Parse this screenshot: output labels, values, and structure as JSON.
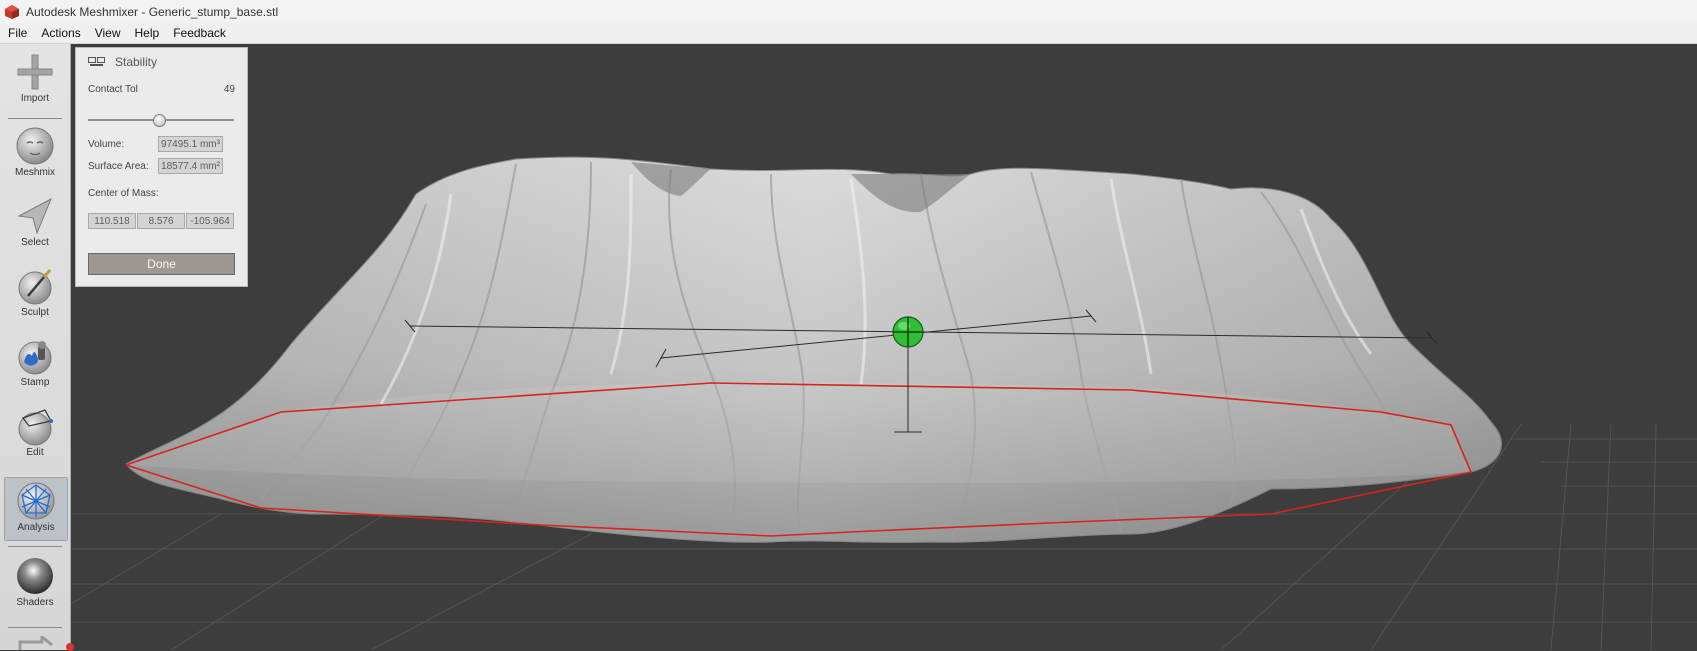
{
  "window": {
    "title": "Autodesk Meshmixer - Generic_stump_base.stl"
  },
  "menu": {
    "items": [
      "File",
      "Actions",
      "View",
      "Help",
      "Feedback"
    ]
  },
  "toolbar": {
    "tools": [
      {
        "label": "Import",
        "icon": "plus-icon"
      },
      {
        "label": "Meshmix",
        "icon": "meshmix-face-icon"
      },
      {
        "label": "Select",
        "icon": "select-arrow-icon"
      },
      {
        "label": "Sculpt",
        "icon": "sculpt-brush-icon"
      },
      {
        "label": "Stamp",
        "icon": "stamp-icon"
      },
      {
        "label": "Edit",
        "icon": "edit-sphere-icon"
      },
      {
        "label": "Analysis",
        "icon": "analysis-globe-icon",
        "active": true
      },
      {
        "label": "Shaders",
        "icon": "shader-ball-icon"
      }
    ]
  },
  "panel": {
    "title": "Stability",
    "contact_tol": {
      "label": "Contact Tol",
      "value": "49",
      "fraction": 0.49
    },
    "volume": {
      "label": "Volume:",
      "value": "97495.1 mm³"
    },
    "surface_area": {
      "label": "Surface Area:",
      "value": "18577.4 mm²"
    },
    "center_of_mass": {
      "label": "Center of Mass:",
      "x": "110.518",
      "y": "8.576",
      "z": "-105.964"
    },
    "done_label": "Done"
  },
  "colors": {
    "viewport_bg": "#3d3d3d",
    "base_outline": "#d8231f",
    "center_marker": "#2fbe35",
    "active_tool_bg": "#bcc2c8"
  }
}
